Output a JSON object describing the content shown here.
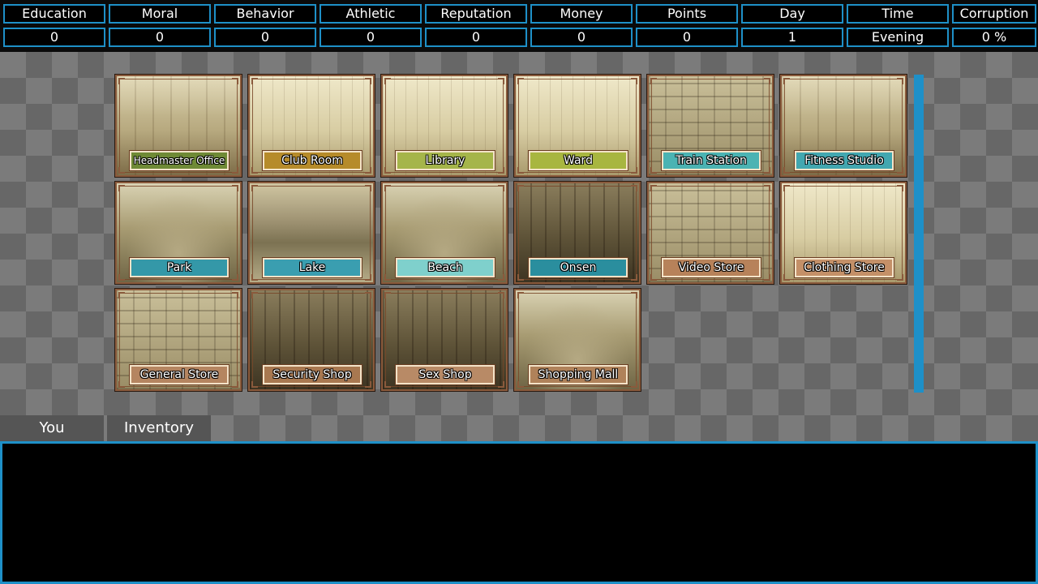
{
  "stats": {
    "labels": [
      "Education",
      "Moral",
      "Behavior",
      "Athletic",
      "Reputation",
      "Money",
      "Points",
      "Day",
      "Time",
      "Corruption"
    ],
    "values": [
      "0",
      "0",
      "0",
      "0",
      "0",
      "0",
      "0",
      "1",
      "Evening",
      "0 %"
    ]
  },
  "locations": [
    {
      "name": "Headmaster Office",
      "color": "#6f8a36"
    },
    {
      "name": "Club Room",
      "color": "#b68b2a"
    },
    {
      "name": "Library",
      "color": "#a5b54a"
    },
    {
      "name": "Ward",
      "color": "#a8b640"
    },
    {
      "name": "Train Station",
      "color": "#4bb3b3"
    },
    {
      "name": "Fitness Studio",
      "color": "#42a7b0"
    },
    {
      "name": "Park",
      "color": "#3498a8"
    },
    {
      "name": "Lake",
      "color": "#3a9eb0"
    },
    {
      "name": "Beach",
      "color": "#7fd0cc"
    },
    {
      "name": "Onsen",
      "color": "#2a8e9e"
    },
    {
      "name": "Video Store",
      "color": "#b7825a"
    },
    {
      "name": "Clothing Store",
      "color": "#c49068"
    },
    {
      "name": "General Store",
      "color": "#b58560"
    },
    {
      "name": "Security Shop",
      "color": "#a87850"
    },
    {
      "name": "Sex Shop",
      "color": "#b88a66"
    },
    {
      "name": "Shopping Mall",
      "color": "#b0825a"
    }
  ],
  "tabs": {
    "you": "You",
    "inventory": "Inventory"
  },
  "textbox": {
    "content": ""
  }
}
